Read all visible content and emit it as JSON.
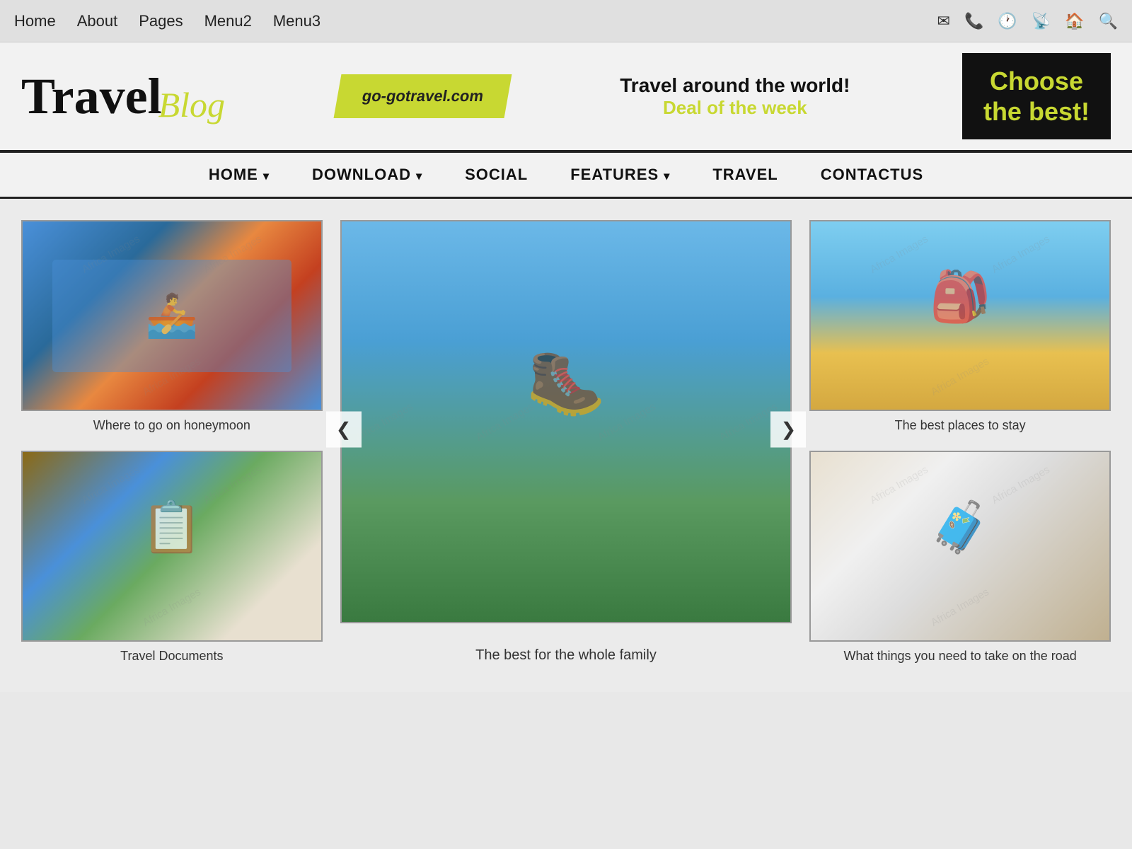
{
  "browser": {
    "nav_links": [
      "Home",
      "About",
      "Pages",
      "Menu2",
      "Menu3"
    ]
  },
  "header": {
    "logo_travel": "Travel",
    "logo_blog": "Blog",
    "url_badge": "go-gotravel.com",
    "tagline_main": "Travel around the world!",
    "tagline_deal": "Deal of the week",
    "cta_line1": "Choose",
    "cta_line2": "the best!"
  },
  "main_nav": {
    "items": [
      {
        "label": "HOME",
        "has_arrow": true
      },
      {
        "label": "DOWNLOAD",
        "has_arrow": true
      },
      {
        "label": "SOCIAL",
        "has_arrow": false
      },
      {
        "label": "FEATURES",
        "has_arrow": true
      },
      {
        "label": "TRAVEL",
        "has_arrow": false
      },
      {
        "label": "CONTACTUS",
        "has_arrow": false
      }
    ]
  },
  "cards": {
    "top_left": {
      "caption": "Where to go on honeymoon",
      "image_type": "kayak"
    },
    "center": {
      "caption": "The best for the whole family",
      "image_type": "hiker"
    },
    "top_right": {
      "caption": "The best places to stay",
      "image_type": "backpacker"
    },
    "bottom_left": {
      "caption": "Travel Documents",
      "image_type": "documents"
    },
    "bottom_right": {
      "caption": "What things you need to take on the road",
      "image_type": "luggage"
    }
  },
  "carousel": {
    "prev_label": "❮",
    "next_label": "❯"
  }
}
